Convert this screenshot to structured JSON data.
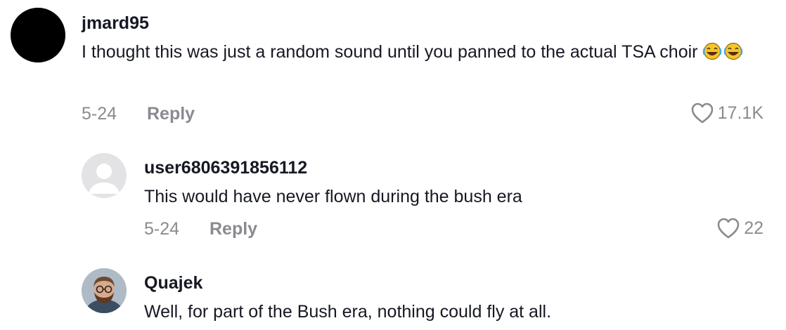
{
  "comments": [
    {
      "username": "jmard95",
      "text": "I thought this was just a random sound until you panned to the actual TSA choir",
      "emoji": "😂😂",
      "date": "5-24",
      "reply_label": "Reply",
      "likes": "17.1K",
      "avatar": "black-circle"
    },
    {
      "username": "user6806391856112",
      "text": "This would have never flown during the bush era",
      "date": "5-24",
      "reply_label": "Reply",
      "likes": "22",
      "avatar": "default-user-avatar"
    },
    {
      "username": "Quajek",
      "text": "Well, for part of the Bush era, nothing could fly at all.",
      "avatar": "profile-photo"
    }
  ],
  "colors": {
    "primary_text": "#161823",
    "secondary_text": "#8a8b91",
    "default_avatar_bg": "#e3e3e6",
    "default_avatar_fg": "#ffffff"
  }
}
